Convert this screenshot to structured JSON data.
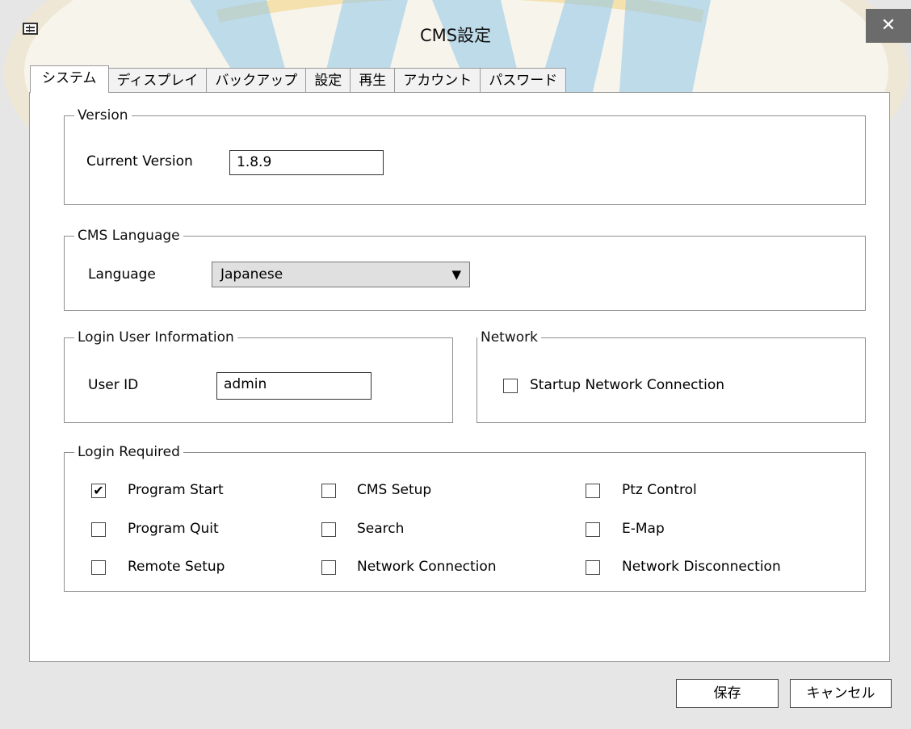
{
  "window": {
    "title": "CMS設定",
    "close_glyph": "✕",
    "icon": "settings-window-icon"
  },
  "tabs": [
    {
      "label": "システム",
      "active": true
    },
    {
      "label": "ディスプレイ",
      "active": false
    },
    {
      "label": "バックアップ",
      "active": false
    },
    {
      "label": "設定",
      "active": false
    },
    {
      "label": "再生",
      "active": false
    },
    {
      "label": "アカウント",
      "active": false
    },
    {
      "label": "パスワード",
      "active": false
    }
  ],
  "version": {
    "group_label": "Version",
    "field_label": "Current Version",
    "value": "1.8.9"
  },
  "language": {
    "group_label": "CMS Language",
    "field_label": "Language",
    "selected": "Japanese",
    "arrow": "▼"
  },
  "login_user": {
    "group_label": "Login User Information",
    "field_label": "User ID",
    "value": "admin"
  },
  "network": {
    "group_label": "Network",
    "startup_label": "Startup Network Connection",
    "startup_checked": false
  },
  "login_required": {
    "group_label": "Login Required",
    "items": [
      {
        "label": "Program Start",
        "checked": true
      },
      {
        "label": "CMS Setup",
        "checked": false
      },
      {
        "label": "Ptz Control",
        "checked": false
      },
      {
        "label": "Program Quit",
        "checked": false
      },
      {
        "label": "Search",
        "checked": false
      },
      {
        "label": "E-Map",
        "checked": false
      },
      {
        "label": "Remote Setup",
        "checked": false
      },
      {
        "label": "Network Connection",
        "checked": false
      },
      {
        "label": "Network Disconnection",
        "checked": false
      }
    ]
  },
  "check_glyph": "✔",
  "buttons": {
    "save": "保存",
    "cancel": "キャンセル"
  },
  "colors": {
    "watermark_blue": "#8fc6ea",
    "watermark_gold": "#f0c040"
  }
}
